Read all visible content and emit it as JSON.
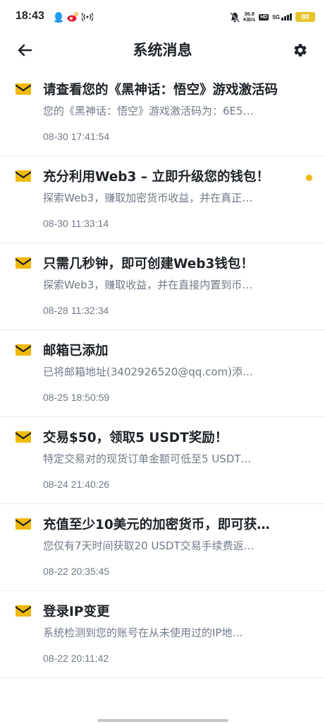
{
  "status_bar": {
    "time": "18:43",
    "net_speed_value": "36.8",
    "net_speed_unit": "KB/s",
    "hd_label": "HD",
    "network_label": "5G",
    "battery": "80"
  },
  "header": {
    "title": "系统消息"
  },
  "messages": [
    {
      "title": "请查看您的《黑神话：悟空》游戏激活码",
      "body": "您的《黑神话：悟空》游戏激活码为：6E5…",
      "time": "08-30 17:41:54",
      "unread": false
    },
    {
      "title": "充分利用Web3 – 立即升级您的钱包！",
      "body": "探索Web3，赚取加密货币收益，并在真正…",
      "time": "08-30 11:33:14",
      "unread": true
    },
    {
      "title": "只需几秒钟，即可创建Web3钱包！",
      "body": "探索Web3，赚取收益，并在直接内置到币…",
      "time": "08-28 11:32:34",
      "unread": false
    },
    {
      "title": "邮箱已添加",
      "body": "已将邮箱地址(3402926520@qq.com)添…",
      "time": "08-25 18:50:59",
      "unread": false
    },
    {
      "title": "交易$50，领取5 USDT奖励！",
      "body": "特定交易对的现货订单金额可低至5 USDT…",
      "time": "08-24 21:40:26",
      "unread": false
    },
    {
      "title": "充值至少10美元的加密货币，即可获…",
      "body": "您仅有7天时间获取20 USDT交易手续费返…",
      "time": "08-22 20:35:45",
      "unread": false
    },
    {
      "title": "登录IP变更",
      "body": "系统检测到您的账号在从未使用过的IP地…",
      "time": "08-22 20:11:42",
      "unread": false
    }
  ],
  "colors": {
    "accent": "#f0b90b",
    "text_primary": "#1e2329",
    "text_secondary": "#707a8a",
    "divider": "#eaecef"
  }
}
